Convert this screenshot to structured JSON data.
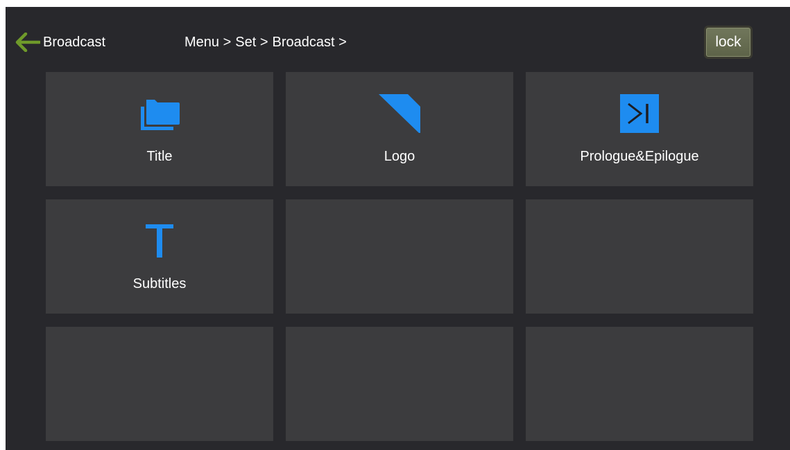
{
  "header": {
    "back_label": "Broadcast",
    "breadcrumb": [
      "Menu >",
      "Set >",
      "Broadcast >"
    ],
    "lock_label": "lock"
  },
  "colors": {
    "accent": "#1e8cf0",
    "back_arrow": "#6f9a2a",
    "background": "#28282c",
    "tile": "#3c3c3e",
    "lock_button": "#656b50"
  },
  "tiles": [
    {
      "label": "Title",
      "icon": "folder-icon"
    },
    {
      "label": "Logo",
      "icon": "logo-icon"
    },
    {
      "label": "Prologue&Epilogue",
      "icon": "skip-forward-icon"
    },
    {
      "label": "Subtitles",
      "icon": "text-t-icon"
    },
    {
      "label": "",
      "icon": ""
    },
    {
      "label": "",
      "icon": ""
    },
    {
      "label": "",
      "icon": ""
    },
    {
      "label": "",
      "icon": ""
    },
    {
      "label": "",
      "icon": ""
    }
  ]
}
